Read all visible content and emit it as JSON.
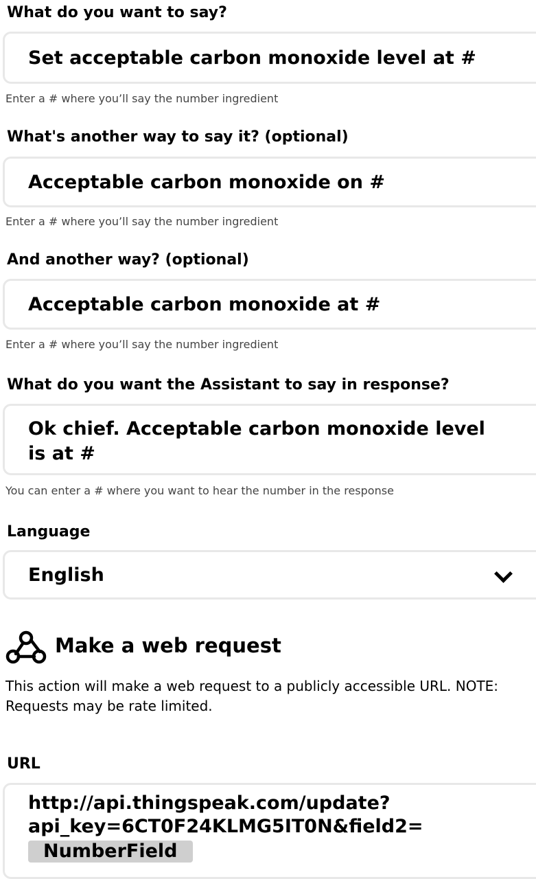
{
  "phrases": [
    {
      "label": "What do you want to say?",
      "value": "Set acceptable carbon monoxide level at #",
      "hint": "Enter a # where you’ll say the number ingredient"
    },
    {
      "label": "What's another way to say it? (optional)",
      "value": "Acceptable carbon monoxide on #",
      "hint": "Enter a # where you’ll say the number ingredient"
    },
    {
      "label": "And another way? (optional)",
      "value": "Acceptable carbon monoxide at #",
      "hint": "Enter a # where you’ll say the number ingredient"
    }
  ],
  "response": {
    "label": "What do you want the Assistant to say in response?",
    "value": "Ok chief. Acceptable carbon monoxide level is at #",
    "hint": "You can enter a # where you want to hear the number in the response"
  },
  "language": {
    "label": "Language",
    "selected": "English"
  },
  "webrequest": {
    "icon": "webhook-icon",
    "title": "Make a web request",
    "description": "This action will make a web request to a publicly accessible URL. NOTE: Requests may be rate limited."
  },
  "url": {
    "label": "URL",
    "line1": "http://api.thingspeak.com/update?",
    "line2": "api_key=6CT0F24KLMG5IT0N&field2=",
    "ingredient": "NumberField"
  }
}
